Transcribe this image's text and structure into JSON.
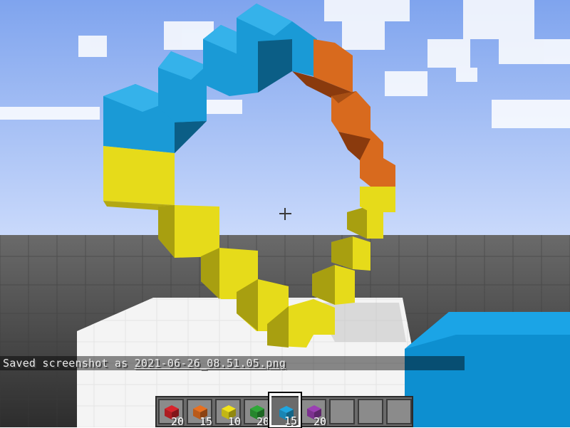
{
  "chat": {
    "prefix": "Saved screenshot as ",
    "filename": "2021-06-26_08.51.05.png"
  },
  "hotbar": {
    "selected_index": 4,
    "slots": [
      {
        "block": "red-wool-block-icon",
        "color": "#d8232b",
        "count": "20"
      },
      {
        "block": "orange-wool-block-icon",
        "color": "#e8701f",
        "count": "15"
      },
      {
        "block": "yellow-wool-block-icon",
        "color": "#f2e31a",
        "count": "10"
      },
      {
        "block": "green-wool-block-icon",
        "color": "#2fa838",
        "count": "20"
      },
      {
        "block": "blue-wool-block-icon",
        "color": "#1fa6e0",
        "count": "15"
      },
      {
        "block": "purple-wool-block-icon",
        "color": "#9b3fb3",
        "count": "20"
      },
      {
        "block": "",
        "color": "",
        "count": ""
      },
      {
        "block": "",
        "color": "",
        "count": ""
      },
      {
        "block": "",
        "color": "",
        "count": ""
      }
    ]
  },
  "colors": {
    "sky": "#9bbcf2",
    "cloud": "#ffffff",
    "floor": "#4a4a4a",
    "platform": "#f4f4f4",
    "blue_block": "#1a9ad6",
    "orange_block": "#d86a1e",
    "yellow_block": "#e6db1a"
  }
}
